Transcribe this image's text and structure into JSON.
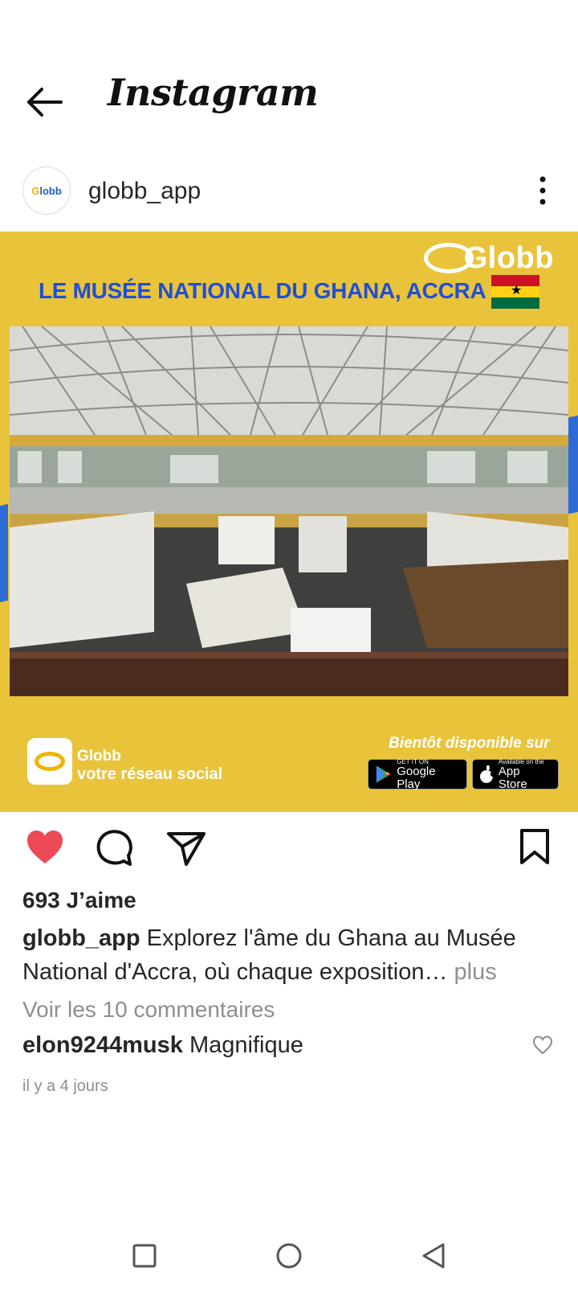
{
  "header": {
    "brand": "Instagram"
  },
  "post": {
    "username": "globb_app",
    "avatar_text": "lobb",
    "image": {
      "logo": "Globb",
      "title": "LE MUSÉE NATIONAL DU GHANA, ACCRA",
      "promo_app_name": "Globb",
      "promo_tagline": "votre réseau social",
      "available_text": "Bientôt disponible sur",
      "google_play_small": "GET IT ON",
      "google_play_big": "Google Play",
      "app_store_small": "Available on the",
      "app_store_big": "App Store"
    },
    "likes": "693 J’aime",
    "caption_user": "globb_app",
    "caption_text": "Explorez l'âme du Ghana au Musée National d'Accra, où chaque exposition…",
    "caption_more": "plus",
    "view_comments": "Voir les 10 commentaires",
    "comment_user": "elon9244musk",
    "comment_text": "Magnifique",
    "time": "il y a 4 jours"
  },
  "colors": {
    "image_bg": "#e9c43b",
    "title_blue": "#1f4fd8",
    "like_red": "#ed4956",
    "muted": "#8e8e8e"
  },
  "icons": [
    "back-arrow-icon",
    "more-vertical-icon",
    "heart-filled-icon",
    "comment-icon",
    "share-icon",
    "bookmark-icon",
    "heart-outline-icon",
    "square-icon",
    "circle-icon",
    "triangle-back-icon"
  ]
}
